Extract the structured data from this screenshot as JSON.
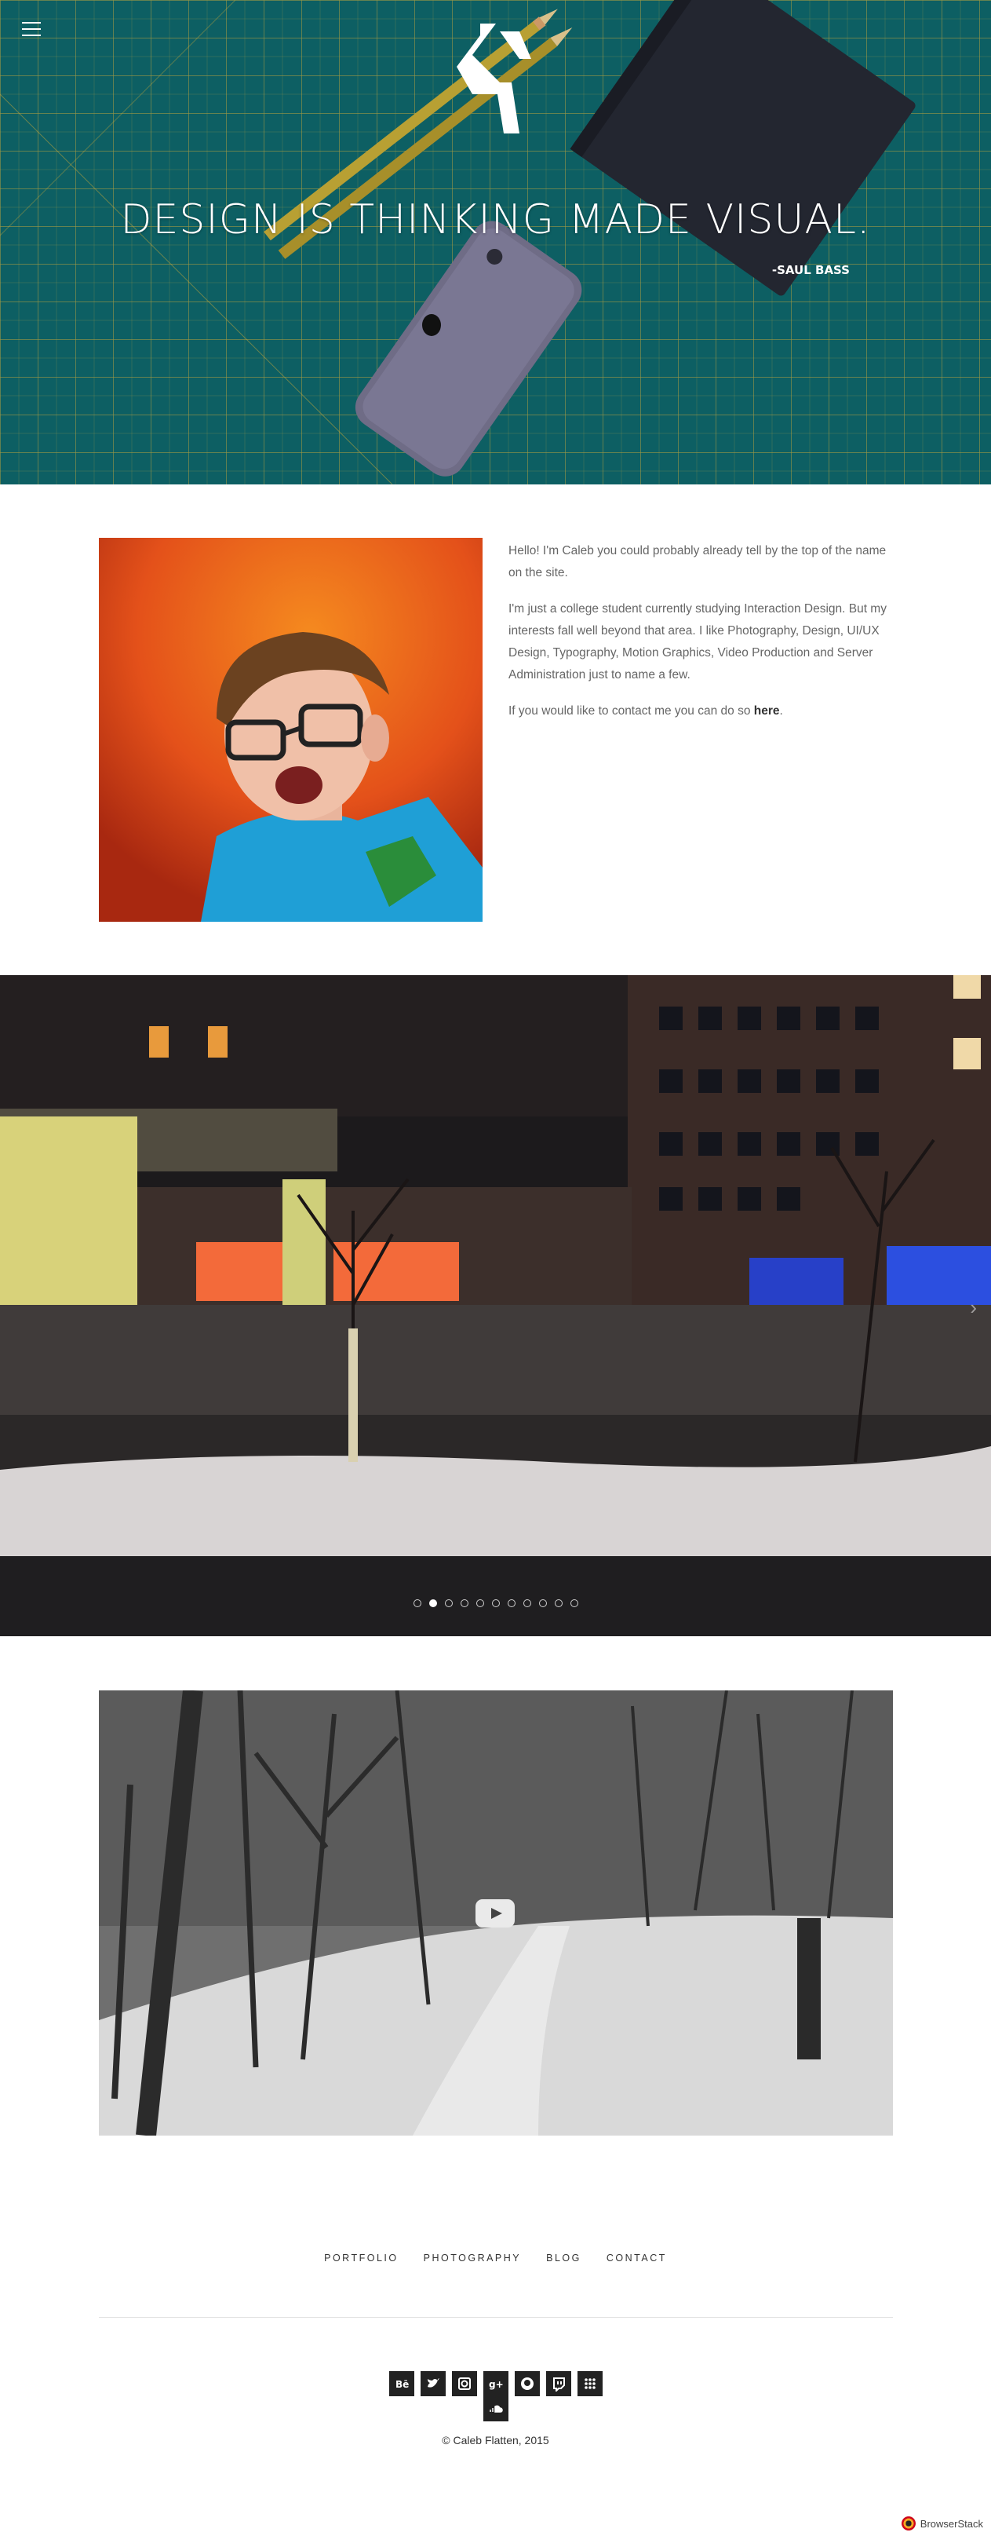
{
  "hero": {
    "quote": "DESIGN IS THINKING MADE VISUAL.",
    "author": "-SAUL BASS",
    "menu_icon": "hamburger-menu-icon",
    "logo_icon": "cf-monogram-logo"
  },
  "about": {
    "p1": "Hello! I'm Caleb you could probably already tell by the top of the name on the site.",
    "p2": "I'm just a college student currently studying Interaction Design. But my interests fall well beyond that area. I like Photography, Design, UI/UX Design, Typography, Motion Graphics, Video Production and Server Administration just to name a few.",
    "p3_prefix": "If you would like to contact me you can do so",
    "p3_link": "here",
    "p3_suffix": "."
  },
  "slider": {
    "slide_count": 11,
    "active_index": 1
  },
  "footer": {
    "nav": [
      "PORTFOLIO",
      "PHOTOGRAPHY",
      "BLOG",
      "CONTACT"
    ],
    "social_icons": [
      "behance-icon",
      "twitter-icon",
      "instagram-icon",
      "google-plus-icon",
      "github-icon",
      "twitch-icon",
      "flickr-icon",
      "soundcloud-icon"
    ],
    "copyright": "© Caleb Flatten, 2015"
  },
  "badge": {
    "text": "BrowserStack"
  },
  "colors": {
    "hero_bg": "#0d5f63",
    "grid_lines": "#c9a93a",
    "footer_text": "#333333"
  }
}
